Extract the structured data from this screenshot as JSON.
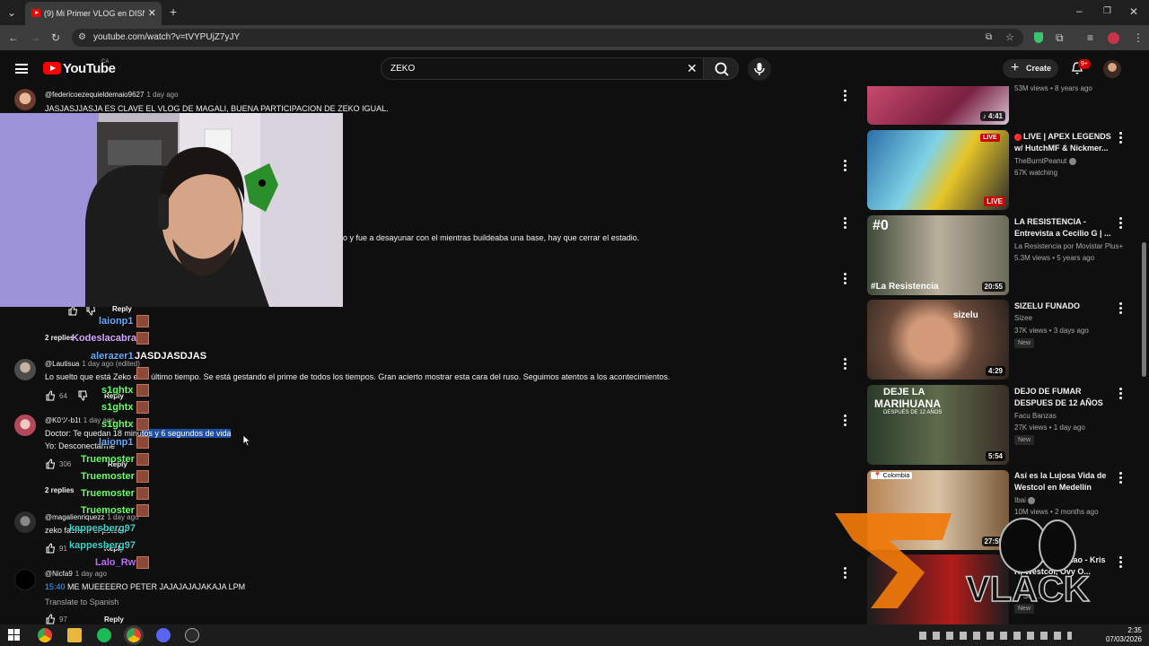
{
  "browser": {
    "tab_title": "(9) Mi Primer VLOG en DISNEY",
    "url": "youtube.com/watch?v=tVYPUjZ7yJY"
  },
  "youtube": {
    "logo_text": "YouTube",
    "country": "CA",
    "search_value": "ZEKO",
    "create_label": "Create",
    "notif_count": "9+"
  },
  "comments": [
    {
      "author": "@federicoezequieldemaio9627",
      "age": "1 day ago",
      "text": "JASJASJJASJA ES CLAVE EL VLOG DE MAGALI, BUENA PARTICIPACION DE ZEKO IGUAL."
    },
    {
      "text_fragment": "o y fue a desayunar con el mientras buildeaba una base, hay que cerrar el estadio."
    },
    {
      "replies_label": "2 replies"
    },
    {
      "author": "@Lautisua",
      "age": "1 day ago (edited)",
      "text": "Lo suelto que está Zeko este último tiempo. Se está gestando el prime de todos los tiempos. Gran acierto mostrar esta cara del ruso. Seguimos atentos a los acontecimientos.",
      "likes": "64",
      "reply": "Reply"
    },
    {
      "author": "@K0ツ-b1t",
      "age": "1 day ago",
      "text_line1_a": "Doctor: Te quedan 18 minu",
      "text_line1_sel": "tos y 6 segundos de vida",
      "text_line2": "Yo: Desconectarme",
      "likes": "306",
      "reply": "Reply"
    },
    {
      "replies_label": "2 replies"
    },
    {
      "author": "@magalienriquezz",
      "age": "1 day ago",
      "text": "zeko fachero el peteco",
      "likes": "91",
      "reply": "Reply"
    },
    {
      "author": "@Nicfa9",
      "age": "1 day ago",
      "timestamp": "15:40",
      "text": " ME MUEEEERO PETER JAJAJAJAJAKAJA LPM",
      "translate": "Translate to Spanish",
      "likes": "97",
      "reply": "Reply"
    }
  ],
  "chat": [
    {
      "user": "laionp1",
      "color": "#6aa9ff"
    },
    {
      "user": "Kodeslacabra",
      "color": "#d9a8ff"
    },
    {
      "user": "alerazer1",
      "color": "#6aa9ff",
      "msg": "JASDJASDJAS"
    },
    {
      "user": "s1ghtx",
      "color": "#6bff6b"
    },
    {
      "user": "s1ghtx",
      "color": "#6bff6b"
    },
    {
      "user": "s1ghtx",
      "color": "#6bff6b"
    },
    {
      "user": "laionp1",
      "color": "#6aa9ff"
    },
    {
      "user": "Truemoster",
      "color": "#6bff6b"
    },
    {
      "user": "Truemoster",
      "color": "#6bff6b"
    },
    {
      "user": "Truemoster",
      "color": "#6bff6b"
    },
    {
      "user": "Truemoster",
      "color": "#6bff6b"
    },
    {
      "user": "kappesberg97",
      "color": "#35d2c8"
    },
    {
      "user": "kappesberg97",
      "color": "#35d2c8"
    },
    {
      "user": "Lalo_Rw",
      "color": "#c070ff"
    }
  ],
  "sidebar": [
    {
      "duration": "4:41",
      "views": "53M views • 8 years ago"
    },
    {
      "title": "LIVE | APEX LEGENDS w/ HutchMF & Nickmer...",
      "channel": "TheBurntPeanut",
      "meta": "67K watching",
      "live": "LIVE"
    },
    {
      "title": "LA RESISTENCIA - Entrevista a Cecilio G | ...",
      "channel": "La Resistencia por Movistar Plus+",
      "meta": "5.3M views • 5 years ago",
      "duration": "20:55"
    },
    {
      "title": "SIZELU FUNADO",
      "channel": "Sizee",
      "meta": "37K views • 3 days ago",
      "badge": "New",
      "duration": "4:29"
    },
    {
      "title": "DEJO DE FUMAR DESPUES DE 12 AÑOS",
      "channel": "Facu Banzas",
      "meta": "27K views • 1 day ago",
      "badge": "New",
      "duration": "5:54"
    },
    {
      "title": "Así es la Lujosa Vida de Westcol en Medellín",
      "channel": "Ibai",
      "meta": "10M views • 2 months ago",
      "duration": "27:59"
    },
    {
      "title": "W...d O...o y Chao - Kris R, Westcol, Ovy O...",
      "channel": "W Sou...",
      "badge": "New"
    }
  ],
  "thumb_text": {
    "sizelu": "sizelu",
    "resistencia": "La Resistencia",
    "marihuana1": "DEJE LA",
    "marihuana2": "MARIHUANA",
    "marihuana3": "DESPUÉS DE 12 AÑOS",
    "colombia": "Colombia"
  },
  "overlay": {
    "brand": "VLACK"
  },
  "taskbar": {
    "time": "2:35",
    "date": "07/03/2026"
  }
}
